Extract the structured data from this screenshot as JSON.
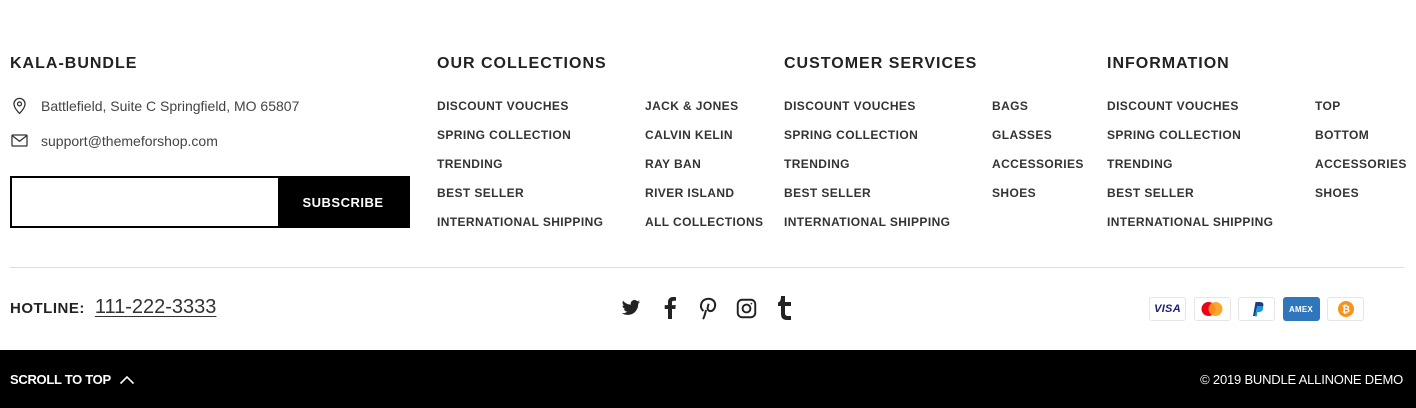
{
  "brand": {
    "title": "KALA-BUNDLE",
    "address": "Battlefield, Suite C Springfield, MO 65807",
    "email": "support@themeforshop.com",
    "subscribe": {
      "placeholder": "",
      "button_label": "SUBSCRIBE"
    }
  },
  "collections": {
    "title": "OUR COLLECTIONS",
    "col1": [
      "DISCOUNT VOUCHES",
      "SPRING COLLECTION",
      "TRENDING",
      "BEST SELLER",
      "INTERNATIONAL SHIPPING"
    ],
    "col2": [
      "JACK & JONES",
      "CALVIN KELIN",
      "RAY BAN",
      "RIVER ISLAND",
      "ALL COLLECTIONS"
    ]
  },
  "customer_services": {
    "title": "CUSTOMER SERVICES",
    "col1": [
      "DISCOUNT VOUCHES",
      "SPRING COLLECTION",
      "TRENDING",
      "BEST SELLER",
      "INTERNATIONAL SHIPPING"
    ],
    "col2": [
      "BAGS",
      "GLASSES",
      "ACCESSORIES",
      "SHOES"
    ]
  },
  "information": {
    "title": "INFORMATION",
    "col1": [
      "DISCOUNT VOUCHES",
      "SPRING COLLECTION",
      "TRENDING",
      "BEST SELLER",
      "INTERNATIONAL SHIPPING"
    ],
    "col2": [
      "TOP",
      "BOTTOM",
      "ACCESSORIES",
      "SHOES"
    ]
  },
  "hotline": {
    "label": "HOTLINE:",
    "number": "111-222-3333"
  },
  "socials": [
    "twitter-icon",
    "facebook-icon",
    "pinterest-icon",
    "instagram-icon",
    "tumblr-icon"
  ],
  "payments": {
    "visa": "VISA",
    "mastercard": "mastercard-icon",
    "paypal": "paypal-icon",
    "amex": "AMEX",
    "bitcoin": "bitcoin-icon"
  },
  "bottom_bar": {
    "scroll_top": "SCROLL TO TOP",
    "copyright": "© 2019 BUNDLE ALLINONE DEMO"
  },
  "colors": {
    "text": "#222222",
    "bar": "#000000",
    "amex": "#2e77bc",
    "paypal_dark": "#253b80",
    "paypal_light": "#179bd7",
    "mc_red": "#eb001b",
    "mc_orange": "#f79e1b",
    "bitcoin": "#f7931a"
  }
}
